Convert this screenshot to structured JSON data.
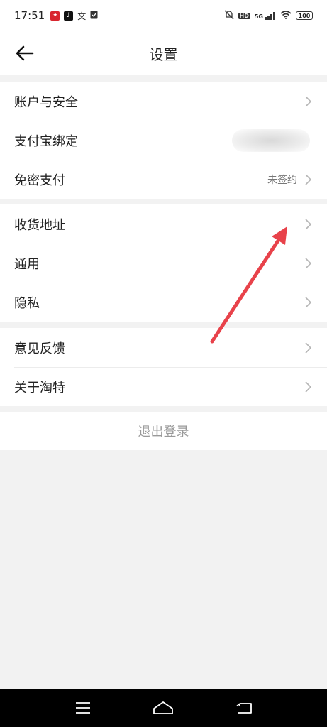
{
  "status_bar": {
    "time": "17:51",
    "network": "5G",
    "battery": "100",
    "hd_label": "HD"
  },
  "header": {
    "title": "设置"
  },
  "groups": [
    {
      "items": [
        {
          "label": "账户与安全",
          "value": ""
        },
        {
          "label": "支付宝绑定",
          "value": ""
        },
        {
          "label": "免密支付",
          "value": "未签约"
        }
      ]
    },
    {
      "items": [
        {
          "label": "收货地址",
          "value": ""
        },
        {
          "label": "通用",
          "value": ""
        },
        {
          "label": "隐私",
          "value": ""
        }
      ]
    },
    {
      "items": [
        {
          "label": "意见反馈",
          "value": ""
        },
        {
          "label": "关于淘特",
          "value": ""
        }
      ]
    }
  ],
  "logout": {
    "label": "退出登录"
  },
  "colors": {
    "background": "#f2f2f2",
    "annotation_arrow": "#e8424a",
    "chevron": "#b5b5b5"
  }
}
